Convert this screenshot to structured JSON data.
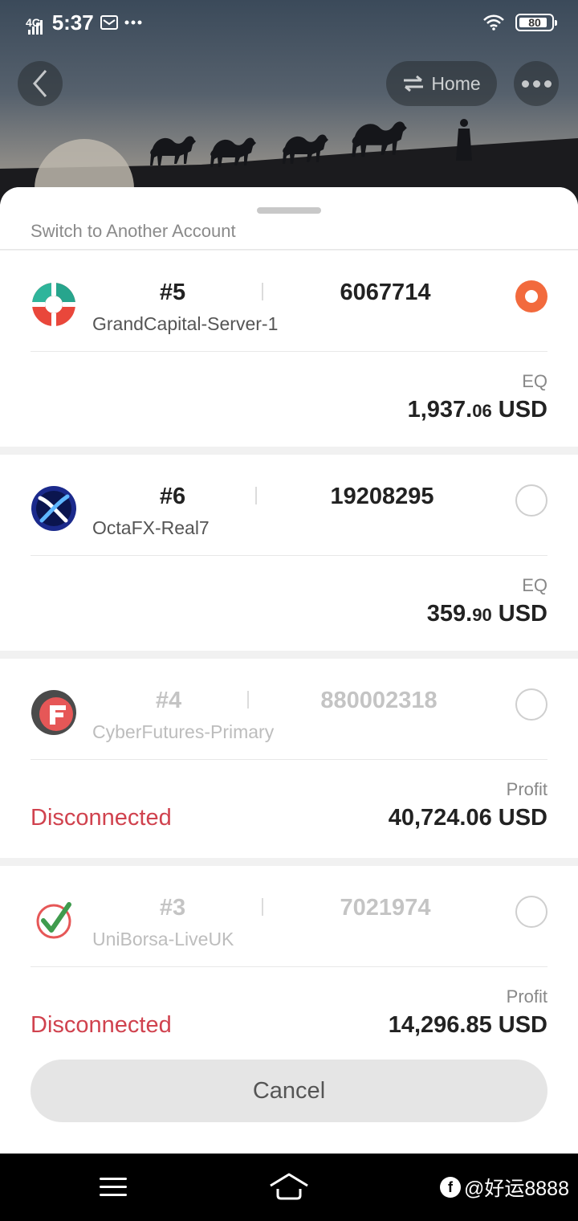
{
  "status_bar": {
    "network": "4G",
    "time": "5:37",
    "battery": "80"
  },
  "header": {
    "home_label": "Home"
  },
  "sheet": {
    "title": "Switch to Another Account",
    "cancel_label": "Cancel"
  },
  "accounts": [
    {
      "number": "#5",
      "login": "6067714",
      "server": "GrandCapital-Server-1",
      "selected": true,
      "metric_label": "EQ",
      "metric_int": "1,937.",
      "metric_dec": "06",
      "metric_unit": " USD",
      "logo_icon": "grandcapital-logo-icon"
    },
    {
      "number": "#6",
      "login": "19208295",
      "server": "OctaFX-Real7",
      "selected": false,
      "metric_label": "EQ",
      "metric_int": "359.",
      "metric_dec": "90",
      "metric_unit": " USD",
      "logo_icon": "octafx-logo-icon"
    },
    {
      "number": "#4",
      "login": "880002318",
      "server": "CyberFutures-Primary",
      "selected": false,
      "status": "Disconnected",
      "metric_label": "Profit",
      "metric_value": "40,724.06 USD",
      "logo_icon": "cyberfutures-logo-icon"
    },
    {
      "number": "#3",
      "login": "7021974",
      "server": "UniBorsa-LiveUK",
      "selected": false,
      "status": "Disconnected",
      "metric_label": "Profit",
      "metric_value": "14,296.85 USD",
      "logo_icon": "uniborsa-logo-icon"
    }
  ],
  "watermark": {
    "text": "@好运8888"
  },
  "colors": {
    "accent": "#f26a3d",
    "disconnected": "#d0424e"
  }
}
